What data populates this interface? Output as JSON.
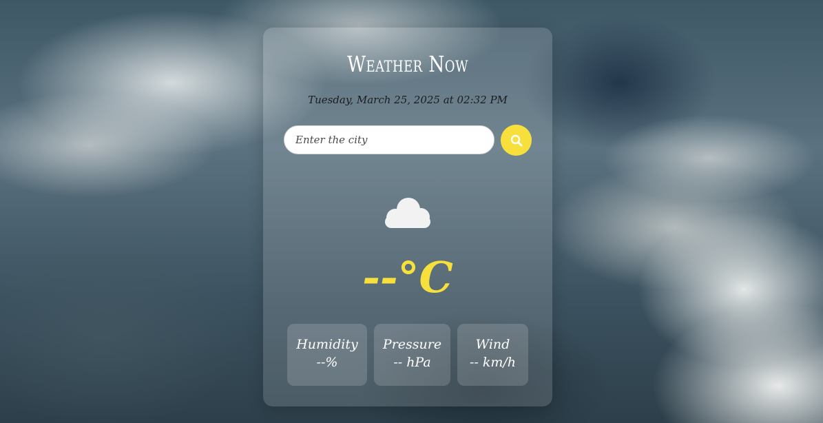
{
  "app": {
    "title": "Weather Now",
    "datetime": "Tuesday, March 25, 2025 at 02:32 PM"
  },
  "search": {
    "placeholder": "Enter the city",
    "value": "",
    "button_icon": "search-icon"
  },
  "weather": {
    "icon": "cloud-icon",
    "temperature": "--°C"
  },
  "stats": {
    "humidity": {
      "label": "Humidity",
      "value": "--%"
    },
    "pressure": {
      "label": "Pressure",
      "value": "-- hPa"
    },
    "wind": {
      "label": "Wind",
      "value": "-- km/h"
    }
  },
  "colors": {
    "accent": "#f7e03c",
    "title": "#ffffff",
    "date_text": "#1c1c1c",
    "stat_text": "#ffffff"
  }
}
